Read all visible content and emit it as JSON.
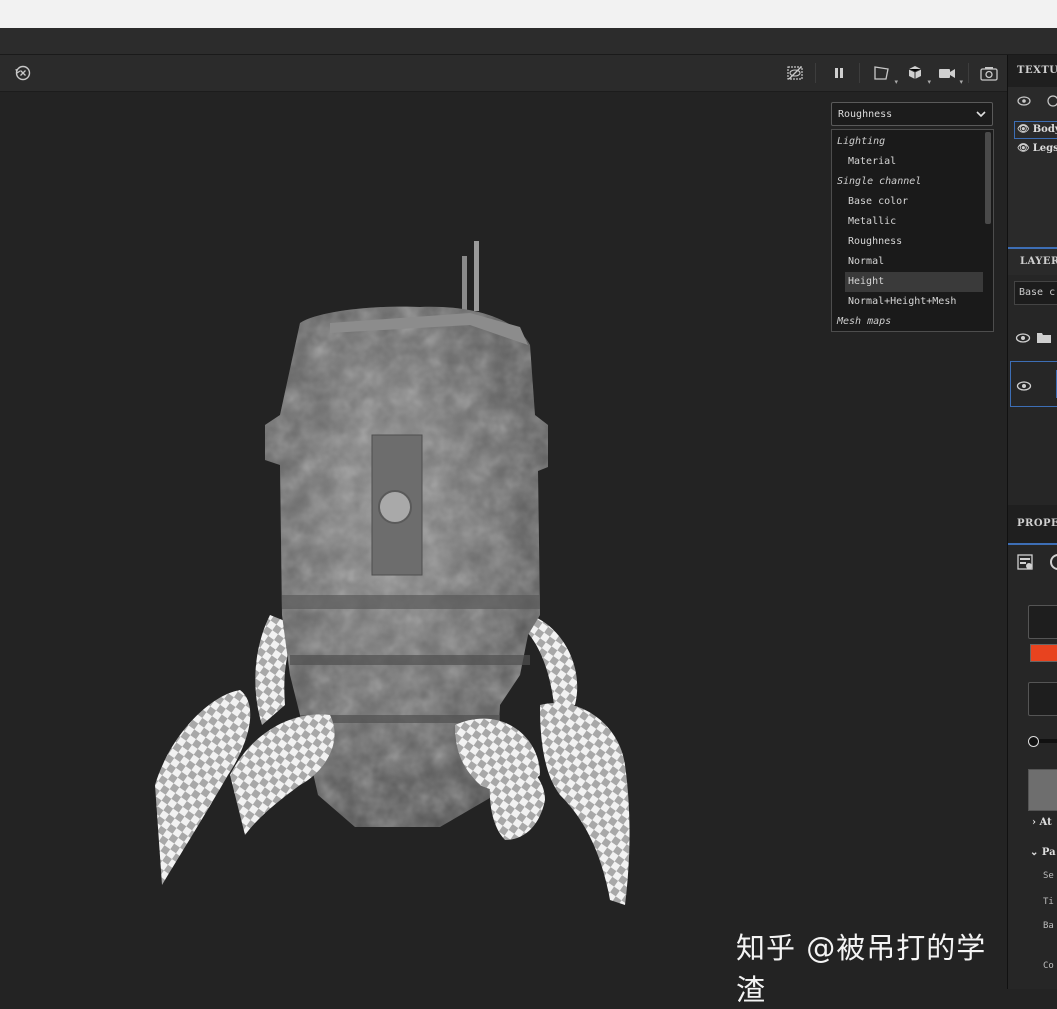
{
  "viewport": {
    "toolbar_icons": [
      "reset-view-icon",
      "hide-ui-icon",
      "pause-icon",
      "perspective-icon",
      "cube-icon",
      "camera-video-icon",
      "screenshot-icon"
    ]
  },
  "display_dropdown": {
    "selected": "Roughness",
    "options": [
      {
        "label": "Lighting",
        "type": "group"
      },
      {
        "label": "Material",
        "type": "item"
      },
      {
        "label": "Single channel",
        "type": "group"
      },
      {
        "label": "Base color",
        "type": "item"
      },
      {
        "label": "Metallic",
        "type": "item"
      },
      {
        "label": "Roughness",
        "type": "item"
      },
      {
        "label": "Normal",
        "type": "item"
      },
      {
        "label": "Height",
        "type": "item",
        "highlighted": true
      },
      {
        "label": "Normal+Height+Mesh",
        "type": "item"
      },
      {
        "label": "Mesh maps",
        "type": "group"
      }
    ]
  },
  "right_panel": {
    "texture_set_title": "TEXTUR",
    "texture_sets": [
      "Body",
      "Legs"
    ],
    "layers_title": "LAYERS",
    "layers_filter": "Base c",
    "properties_title": "PROPER",
    "properties_rows": [
      "At",
      "Pa",
      "Se",
      "Ti",
      "Ba",
      "Co"
    ],
    "accent_color": "#e8431f",
    "selection_color": "#3d6eb5"
  },
  "watermark": "知乎 @被吊打的学渣"
}
